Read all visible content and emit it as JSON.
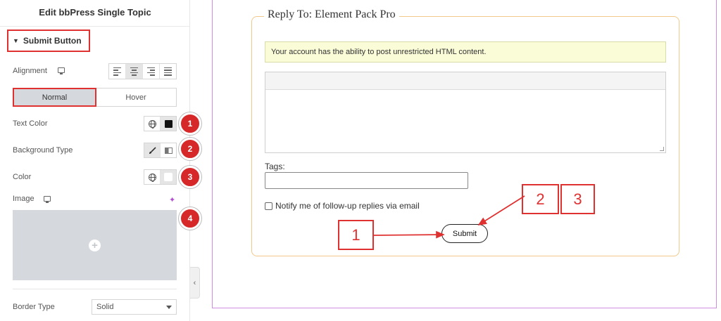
{
  "panel": {
    "title": "Edit bbPress Single Topic",
    "section_label": "Submit Button",
    "alignment_label": "Alignment",
    "state_tabs": [
      "Normal",
      "Hover"
    ],
    "text_color_label": "Text Color",
    "background_type_label": "Background Type",
    "color_label": "Color",
    "image_label": "Image",
    "border_type_label": "Border Type",
    "border_type_value": "Solid",
    "badges": [
      "1",
      "2",
      "3",
      "4"
    ]
  },
  "preview": {
    "legend": "Reply To: Element Pack Pro",
    "notice": "Your account has the ability to post unrestricted HTML content.",
    "tags_label": "Tags:",
    "notify_label": "Notify me of follow-up replies via email",
    "submit_label": "Submit"
  },
  "callouts": [
    "1",
    "2",
    "3"
  ],
  "colors": {
    "highlight": "#e03131",
    "badge": "#d62828",
    "notice_bg": "#fafbd7",
    "fieldset_border": "#f2c98a",
    "canvas_border": "#d08ee0"
  }
}
